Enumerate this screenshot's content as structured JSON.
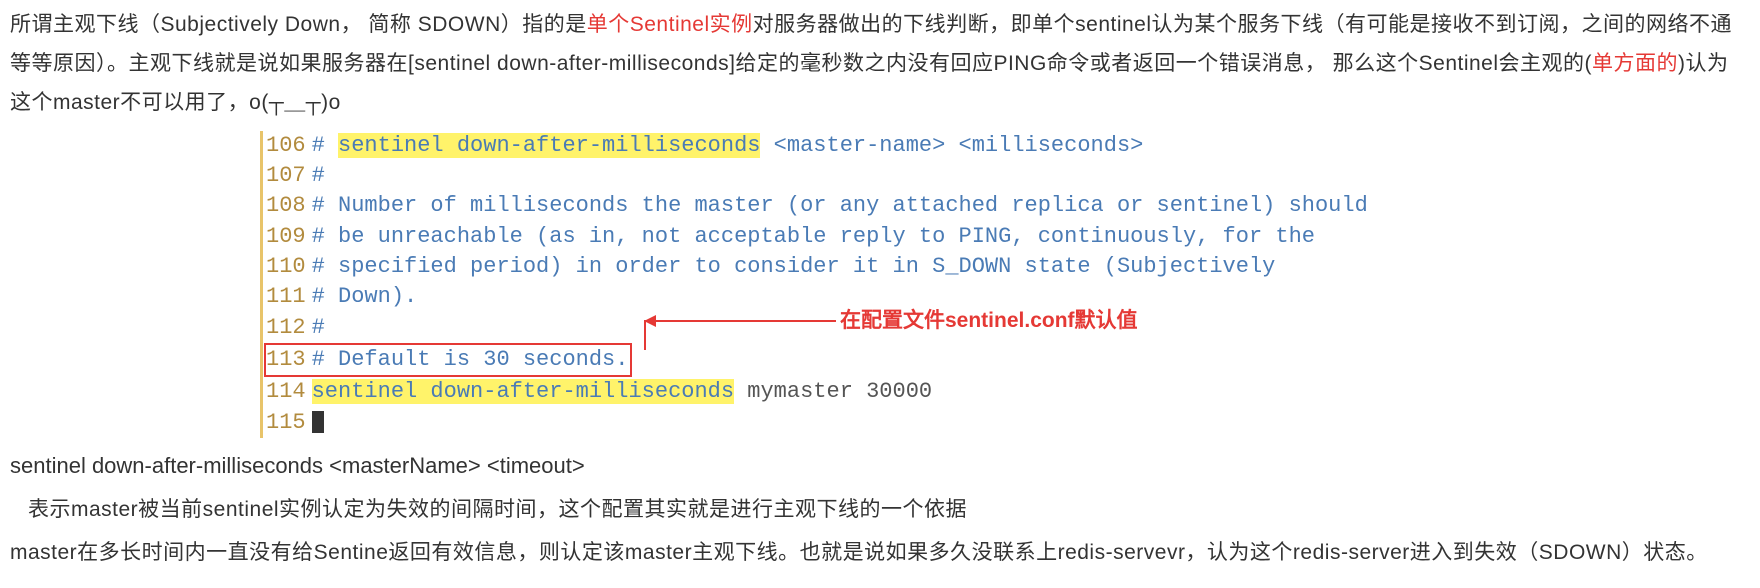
{
  "para1": {
    "t1": "所谓主观下线（Subjectively Down， 简称 SDOWN）指的是",
    "t2": "单个Sentinel实例",
    "t3": "对服务器做出的下线判断，即单个sentinel认为某个服务下线（有可能是接收不到订阅，之间的网络不通等等原因）。主观下线就是说如果服务器在[sentinel down-after-milliseconds]给定的毫秒数之内没有回应PING命令或者返回一个错误消息， 那么这个Sentinel会主观的(",
    "t4": "单方面的",
    "t5": ")认为这个master不可以用了，o(┬＿┬)o"
  },
  "code": {
    "lines": [
      {
        "no": "106",
        "c": "# ",
        "hl": "sentinel down-after-milliseconds",
        "after": " <master-name> <milliseconds>",
        "type": "hl"
      },
      {
        "no": "107",
        "c": "#",
        "type": "comment"
      },
      {
        "no": "108",
        "c": "# Number of milliseconds the master (or any attached replica or sentinel) should",
        "type": "comment"
      },
      {
        "no": "109",
        "c": "# be unreachable (as in, not acceptable reply to PING, continuously, for the",
        "type": "comment"
      },
      {
        "no": "110",
        "c": "# specified period) in order to consider it in S_DOWN state (Subjectively",
        "type": "comment"
      },
      {
        "no": "111",
        "c": "# Down).",
        "type": "comment"
      },
      {
        "no": "112",
        "c": "#",
        "type": "comment"
      },
      {
        "no": "113",
        "c": "# Default is 30 seconds.",
        "type": "boxed"
      },
      {
        "no": "114",
        "hl": "sentinel down-after-milliseconds",
        "after": " mymaster 30000",
        "type": "cfg"
      },
      {
        "no": "115",
        "c": "",
        "type": "cursor"
      }
    ],
    "annotation": "在配置文件sentinel.conf默认值"
  },
  "syntax": "sentinel down-after-milliseconds <masterName> <timeout>",
  "para2": "表示master被当前sentinel实例认定为失效的间隔时间，这个配置其实就是进行主观下线的一个依据",
  "para3": "master在多长时间内一直没有给Sentine返回有效信息，则认定该master主观下线。也就是说如果多久没联系上redis-servevr，认为这个redis-server进入到失效（SDOWN）状态。"
}
